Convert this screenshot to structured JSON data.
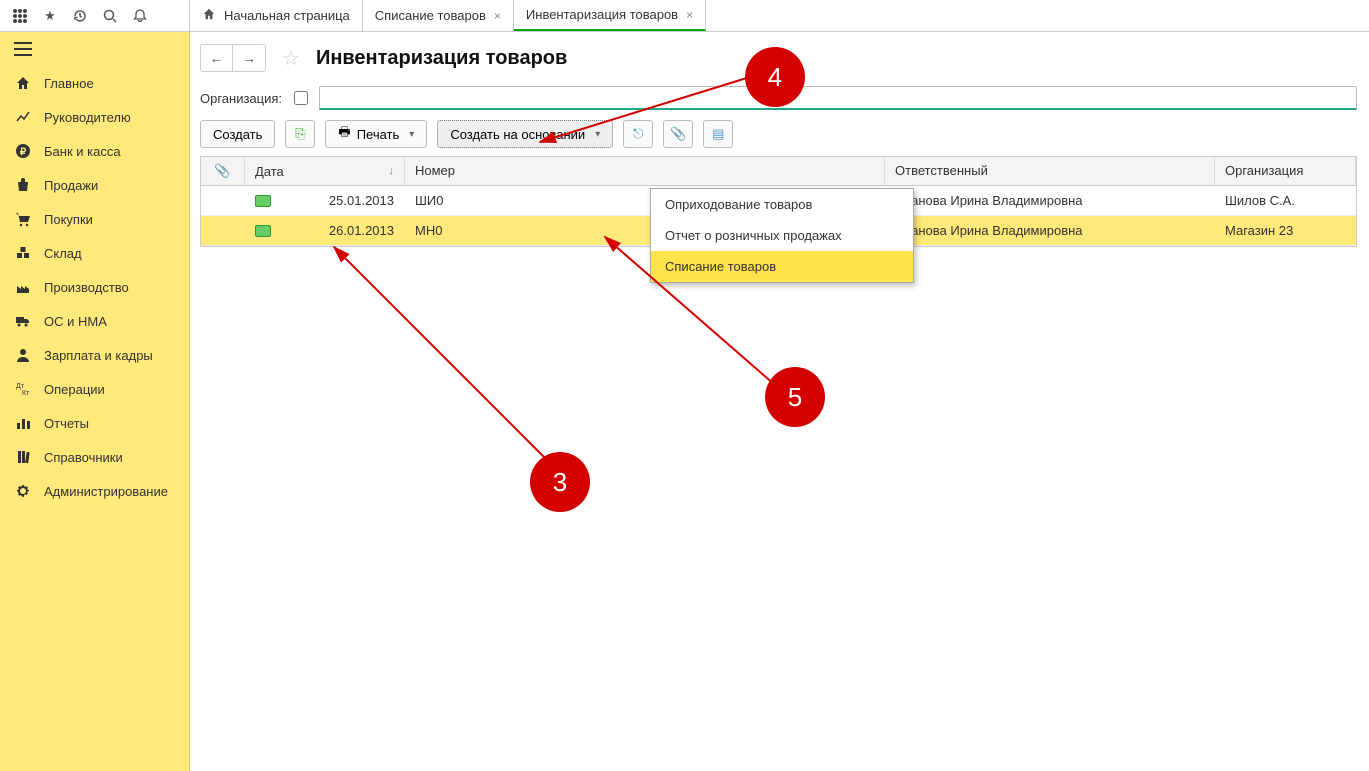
{
  "tabs": {
    "home": "Начальная страница",
    "t1": "Списание товаров",
    "t2": "Инвентаризация товаров"
  },
  "sidebar": {
    "items": [
      "Главное",
      "Руководителю",
      "Банк и касса",
      "Продажи",
      "Покупки",
      "Склад",
      "Производство",
      "ОС и НМА",
      "Зарплата и кадры",
      "Операции",
      "Отчеты",
      "Справочники",
      "Администрирование"
    ]
  },
  "page": {
    "title": "Инвентаризация товаров",
    "org_label": "Организация:"
  },
  "toolbar": {
    "create": "Создать",
    "print": "Печать",
    "create_based": "Создать на основании"
  },
  "dropdown": {
    "i1": "Оприходование товаров",
    "i2": "Отчет о розничных продажах",
    "i3": "Списание товаров"
  },
  "columns": {
    "date": "Дата",
    "number": "Номер",
    "responsible": "Ответственный",
    "org": "Организация"
  },
  "rows": [
    {
      "date": "25.01.2013",
      "number": "ШИ0",
      "responsible": "Иванова Ирина Владимировна",
      "org": "Шилов С.А."
    },
    {
      "date": "26.01.2013",
      "number": "МН0",
      "responsible": "Иванова Ирина Владимировна",
      "org": "Магазин 23"
    }
  ],
  "annotations": {
    "n3": "3",
    "n4": "4",
    "n5": "5"
  }
}
